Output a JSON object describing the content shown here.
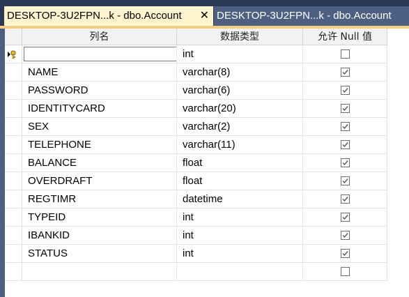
{
  "tabs": [
    {
      "label": "DESKTOP-3U2FPN...k - dbo.Account",
      "close": "✕",
      "active": true
    },
    {
      "label": "DESKTOP-3U2FPN...k - dbo.Account",
      "active": false
    }
  ],
  "table": {
    "headers": {
      "name": "列名",
      "type": "数据类型",
      "nullable": "允许 Null 值"
    },
    "rows": [
      {
        "name": "",
        "type": "int",
        "allow_null": false,
        "editing": true,
        "row_icon": "key-pencil-icon"
      },
      {
        "name": "NAME",
        "type": "varchar(8)",
        "allow_null": true
      },
      {
        "name": "PASSWORD",
        "type": "varchar(6)",
        "allow_null": true
      },
      {
        "name": "IDENTITYCARD",
        "type": "varchar(20)",
        "allow_null": true
      },
      {
        "name": "SEX",
        "type": "varchar(2)",
        "allow_null": true
      },
      {
        "name": "TELEPHONE",
        "type": "varchar(11)",
        "allow_null": true
      },
      {
        "name": "BALANCE",
        "type": "float",
        "allow_null": true
      },
      {
        "name": "OVERDRAFT",
        "type": "float",
        "allow_null": true
      },
      {
        "name": "REGTIMR",
        "type": "datetime",
        "allow_null": true
      },
      {
        "name": "TYPEID",
        "type": "int",
        "allow_null": true
      },
      {
        "name": "IBANKID",
        "type": "int",
        "allow_null": true
      },
      {
        "name": "STATUS",
        "type": "int",
        "allow_null": true
      },
      {
        "name": "",
        "type": "",
        "allow_null": false
      }
    ]
  },
  "colors": {
    "tab_strip": "#293955",
    "active_tab": "#fff4cc",
    "inactive_tab": "#4d6082",
    "accent_line": "#f5cc84"
  }
}
